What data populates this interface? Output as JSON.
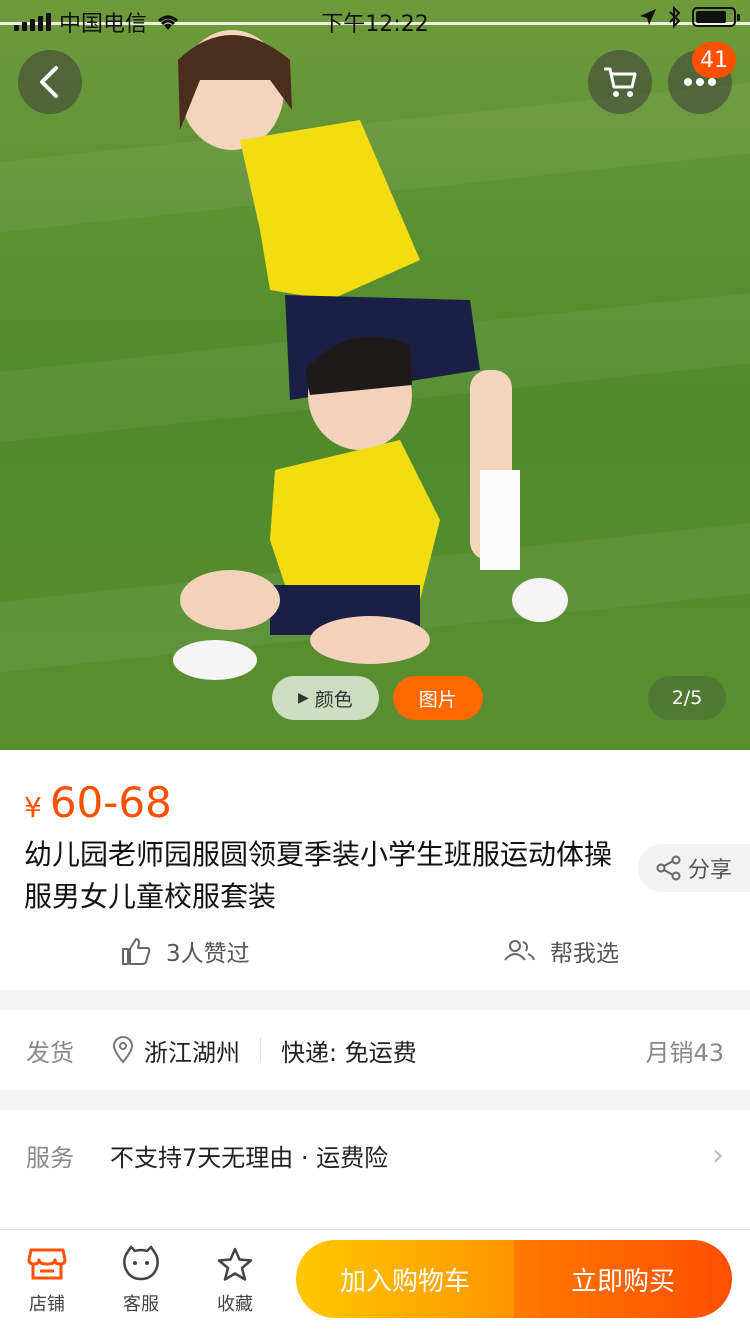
{
  "status_bar": {
    "carrier": "中国电信",
    "time": "下午12:22"
  },
  "hero": {
    "cart_badge": "41",
    "tabs": [
      "颜色",
      "图片"
    ],
    "active_tab": "图片",
    "counter": "2/5"
  },
  "product": {
    "currency": "¥",
    "price": "60-68",
    "title": "幼儿园老师园服圆领夏季装小学生班服运动体操服男女儿童校服套装",
    "share_label": "分享",
    "likes_label": "3人赞过",
    "help_label": "帮我选"
  },
  "shipping": {
    "label": "发货",
    "location": "浙江湖州",
    "express": "快递: 免运费",
    "monthly_sales": "月销43"
  },
  "service": {
    "label": "服务",
    "value": "不支持7天无理由 · 运费险"
  },
  "bottom_bar": {
    "shop": "店铺",
    "support": "客服",
    "favorite": "收藏",
    "add_to_cart": "加入购物车",
    "buy_now": "立即购买"
  },
  "colors": {
    "accent": "#ff5000",
    "cart_gradient_start": "#ffc800",
    "buy_gradient_end": "#ff4e00"
  }
}
